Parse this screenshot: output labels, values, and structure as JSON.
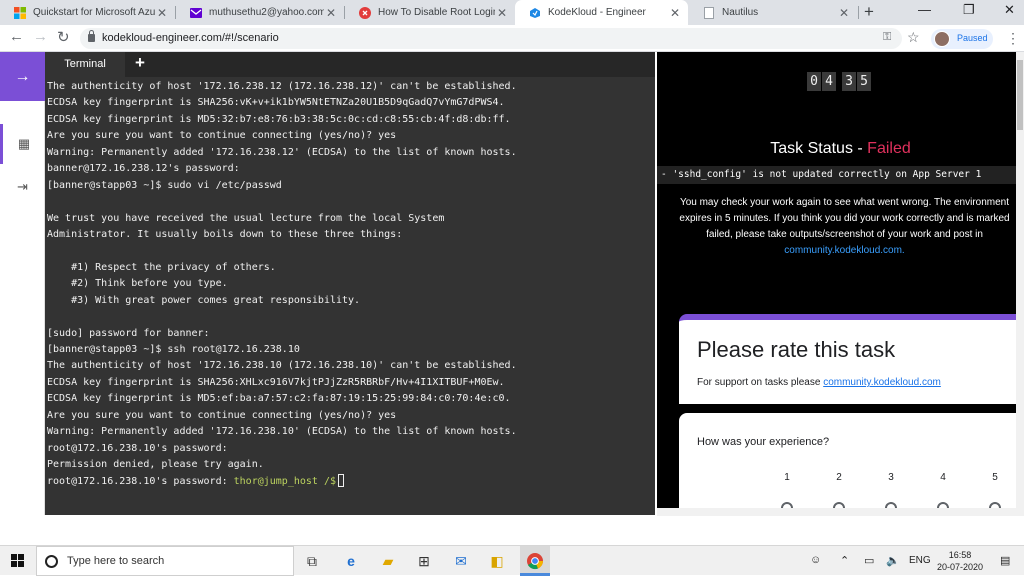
{
  "browser": {
    "tabs": [
      {
        "title": "Quickstart for Microsoft Azure"
      },
      {
        "title": "muthusethu2@yahoo.com - Ya"
      },
      {
        "title": "How To Disable Root Logins O"
      },
      {
        "title": "KodeKloud - Engineer"
      },
      {
        "title": "Nautilus"
      }
    ],
    "new_tab_label": "+",
    "url": "kodekloud-engineer.com/#!/scenario",
    "profile_label": "Paused"
  },
  "terminal": {
    "tab_label": "Terminal",
    "lines": [
      "The authenticity of host '172.16.238.12 (172.16.238.12)' can't be established.",
      "ECDSA key fingerprint is SHA256:vK+v+ik1bYW5NtETNZa20U1B5D9qGadQ7vYmG7dPWS4.",
      "ECDSA key fingerprint is MD5:32:b7:e8:76:b3:38:5c:0c:cd:c8:55:cb:4f:d8:db:ff.",
      "Are you sure you want to continue connecting (yes/no)? yes",
      "Warning: Permanently added '172.16.238.12' (ECDSA) to the list of known hosts.",
      "banner@172.16.238.12's password:",
      "[banner@stapp03 ~]$ sudo vi /etc/passwd",
      "",
      "We trust you have received the usual lecture from the local System",
      "Administrator. It usually boils down to these three things:",
      "",
      "    #1) Respect the privacy of others.",
      "    #2) Think before you type.",
      "    #3) With great power comes great responsibility.",
      "",
      "[sudo] password for banner:",
      "[banner@stapp03 ~]$ ssh root@172.16.238.10",
      "The authenticity of host '172.16.238.10 (172.16.238.10)' can't be established.",
      "ECDSA key fingerprint is SHA256:XHLxc916V7kjtPJjZzR5RBRbF/Hv+4I1XITBUF+M0Ew.",
      "ECDSA key fingerprint is MD5:ef:ba:a7:57:c2:fa:87:19:15:25:99:84:c0:70:4e:c0.",
      "Are you sure you want to continue connecting (yes/no)? yes",
      "Warning: Permanently added '172.16.238.10' (ECDSA) to the list of known hosts.",
      "root@172.16.238.10's password:",
      "Permission denied, please try again."
    ],
    "last_line_prefix": "root@172.16.238.10's password: ",
    "last_line_prompt": "thor@jump_host /$"
  },
  "task": {
    "timer_digits": [
      "0",
      "4",
      "3",
      "5"
    ],
    "status_label": "Task Status - ",
    "status_value": "Failed",
    "failure_message": "- 'sshd_config' is not updated correctly on App Server 1",
    "info_text": "You may check your work again to see what went wrong. The environment expires in 5 minutes. If you think you did your work correctly and is marked failed, please take outputs/screenshot of your work and post in",
    "info_link": "community.kodekloud.com."
  },
  "rating": {
    "title": "Please rate this task",
    "support_prefix": "For support on tasks please ",
    "support_link": "community.kodekloud.com",
    "question": "How was your experience?",
    "scale": [
      "1",
      "2",
      "3",
      "4",
      "5"
    ]
  },
  "taskbar": {
    "search_placeholder": "Type here to search",
    "language": "ENG",
    "time": "16:58",
    "date": "20-07-2020"
  },
  "colors": {
    "accent": "#7b4fd6",
    "failed": "#e0315d",
    "link": "#3aa0ff",
    "prompt": "#bcd35f"
  }
}
